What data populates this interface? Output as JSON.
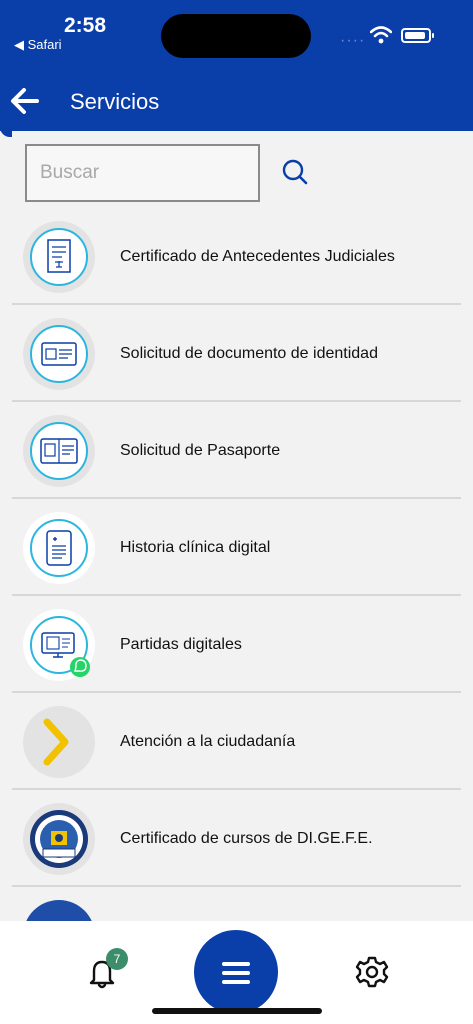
{
  "status": {
    "time": "2:58",
    "back_app": "◀ Safari",
    "dots": "····"
  },
  "header": {
    "title": "Servicios"
  },
  "search": {
    "placeholder": "Buscar"
  },
  "services": [
    {
      "label": "Certificado de Antecedentes Judiciales",
      "icon": "document-scale-icon"
    },
    {
      "label": "Solicitud de documento de identidad",
      "icon": "id-card-icon"
    },
    {
      "label": "Solicitud de Pasaporte",
      "icon": "passport-icon"
    },
    {
      "label": "Historia clínica digital",
      "icon": "medical-record-icon"
    },
    {
      "label": "Partidas digitales",
      "icon": "digital-certificate-whatsapp-icon"
    },
    {
      "label": "Atención a la ciudadanía",
      "icon": "chevron-right-icon"
    },
    {
      "label": "Certificado de cursos de DI.GE.F.E.",
      "icon": "digefe-seal-icon"
    }
  ],
  "bottom_nav": {
    "notifications_count": "7"
  },
  "colors": {
    "primary": "#0a3ea8",
    "accent_cyan": "#2bb6e0",
    "accent_yellow": "#f2c200",
    "badge_green": "#3c8e6b"
  }
}
